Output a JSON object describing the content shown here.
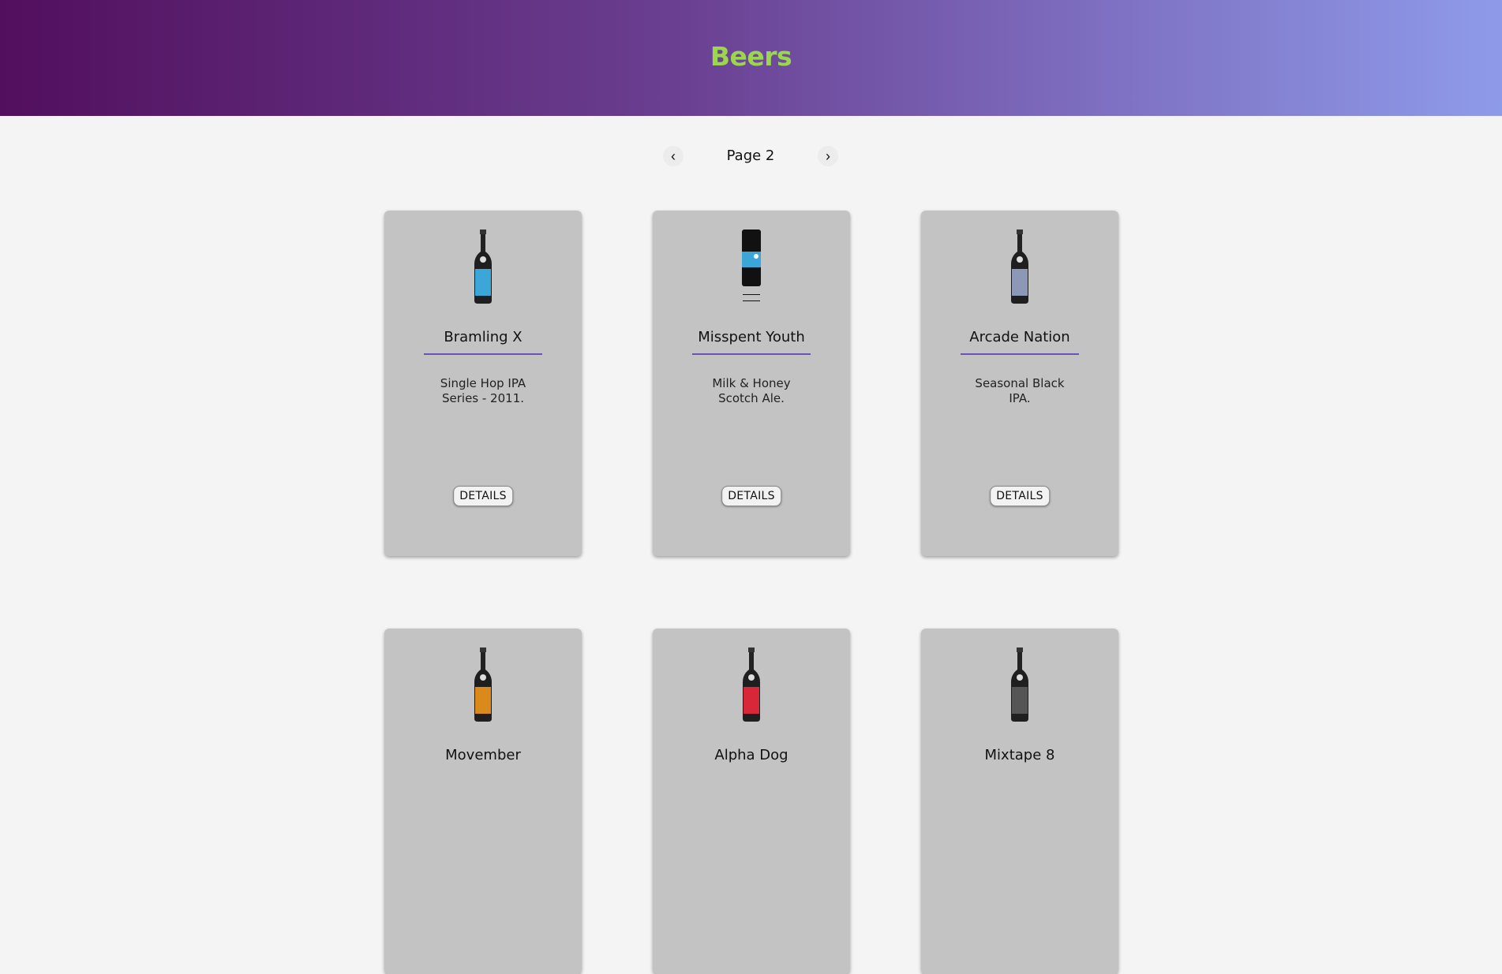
{
  "header": {
    "title": "Beers"
  },
  "pager": {
    "prev_label": "‹",
    "page_label": "Page 2",
    "next_label": "›"
  },
  "cards": [
    {
      "name": "Bramling X",
      "description": "Single Hop IPA Series - 2011.",
      "button": "DETAILS",
      "label_color": "#3aa7d8"
    },
    {
      "name": "Misspent Youth",
      "description": "Milk & Honey Scotch Ale.",
      "button": "DETAILS",
      "label_color": "#3aa7d8"
    },
    {
      "name": "Arcade Nation",
      "description": "Seasonal Black IPA.",
      "button": "DETAILS",
      "label_color": "#8c98b5"
    },
    {
      "name": "Movember",
      "description": "",
      "button": "",
      "label_color": "#d98a1a"
    },
    {
      "name": "Alpha Dog",
      "description": "",
      "button": "",
      "label_color": "#d9273a"
    },
    {
      "name": "Mixtape 8",
      "description": "",
      "button": "",
      "label_color": "#555555"
    }
  ],
  "colors": {
    "title": "#9bd64e",
    "accent_rule": "#6b52b8",
    "card_bg": "#c3c3c3"
  }
}
